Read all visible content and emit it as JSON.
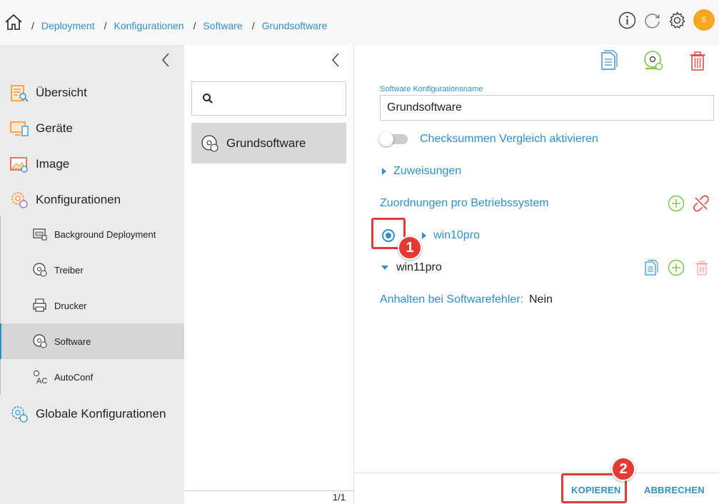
{
  "breadcrumb": {
    "separator": "/",
    "items": [
      "Deployment",
      "Konfigurationen",
      "Software",
      "Grundsoftware"
    ]
  },
  "user": {
    "avatar_initial": "S",
    "avatar_color": "#f5a623"
  },
  "colors": {
    "accent": "#2e90c9",
    "danger": "#e53935",
    "success": "#7cc242"
  },
  "nav": {
    "items": {
      "uebersicht": "Übersicht",
      "geraete": "Geräte",
      "image": "Image",
      "konfigurationen": "Konfigurationen",
      "globale": "Globale Konfigurationen"
    },
    "sub": {
      "background": "Background Deployment",
      "treiber": "Treiber",
      "drucker": "Drucker",
      "software": "Software",
      "autoconf": "AutoConf"
    },
    "active_item": "Software"
  },
  "list": {
    "search_placeholder": "",
    "items": [
      "Grundsoftware"
    ],
    "pager": "1/1"
  },
  "detail": {
    "name_label": "Software Konfigurationsname",
    "name_value": "Grundsoftware",
    "checksum_label": "Checksummen Vergleich aktivieren",
    "checksum_enabled": false,
    "zuweisungen": "Zuweisungen",
    "os_section": "Zuordnungen pro Betriebssystem",
    "os_items": [
      "win10pro",
      "win11pro"
    ],
    "selected_os": "win10pro",
    "halt_label": "Anhalten bei Softwarefehler:",
    "halt_value": "Nein"
  },
  "footer": {
    "copy": "KOPIEREN",
    "cancel": "ABBRECHEN"
  },
  "annotations": {
    "badge1": "1",
    "badge2": "2"
  }
}
